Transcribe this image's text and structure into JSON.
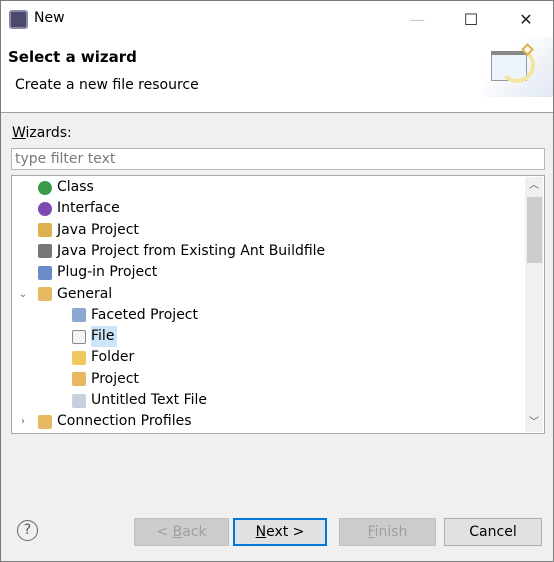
{
  "window": {
    "title": "New",
    "controls": [
      "minimize",
      "maximize",
      "close"
    ]
  },
  "header": {
    "title": "Select a wizard",
    "description": "Create a new file resource"
  },
  "wizards_label": "Wizards:",
  "filter": {
    "placeholder": "type filter text",
    "value": ""
  },
  "tree": {
    "items": [
      {
        "label": "Class",
        "icon": "class-icon",
        "depth": 0,
        "color": "#3a9a4a"
      },
      {
        "label": "Interface",
        "icon": "interface-icon",
        "depth": 0,
        "color": "#7a4ab0"
      },
      {
        "label": "Java Project",
        "icon": "java-project-icon",
        "depth": 0,
        "color": "#e0b050"
      },
      {
        "label": "Java Project from Existing Ant Buildfile",
        "icon": "ant-icon",
        "depth": 0,
        "color": "#777777"
      },
      {
        "label": "Plug-in Project",
        "icon": "plugin-project-icon",
        "depth": 0,
        "color": "#6a8ac8"
      },
      {
        "label": "General",
        "icon": "folder-open-icon",
        "depth": 0,
        "expanded": true,
        "color": "#e8b860"
      },
      {
        "label": "Faceted Project",
        "icon": "faceted-project-icon",
        "depth": 1,
        "color": "#8aa8d0"
      },
      {
        "label": "File",
        "icon": "file-icon",
        "depth": 1,
        "selected": true,
        "color": "#f4f4f4"
      },
      {
        "label": "Folder",
        "icon": "folder-icon",
        "depth": 1,
        "color": "#f0c860"
      },
      {
        "label": "Project",
        "icon": "project-icon",
        "depth": 1,
        "color": "#e8b860"
      },
      {
        "label": "Untitled Text File",
        "icon": "text-file-icon",
        "depth": 1,
        "color": "#c8d0e0"
      },
      {
        "label": "Connection Profiles",
        "icon": "folder-open-icon",
        "depth": 0,
        "expanded": false,
        "color": "#e8b860"
      }
    ]
  },
  "buttons": {
    "back": {
      "pre": "< ",
      "u": "B",
      "post": "ack",
      "enabled": false
    },
    "next": {
      "u": "N",
      "post": "ext >",
      "enabled": true
    },
    "finish": {
      "u": "F",
      "post": "inish",
      "enabled": false
    },
    "cancel": {
      "label": "Cancel",
      "enabled": true
    }
  },
  "colors": {
    "selection": "#cce4f7",
    "focus": "#0078d7"
  }
}
